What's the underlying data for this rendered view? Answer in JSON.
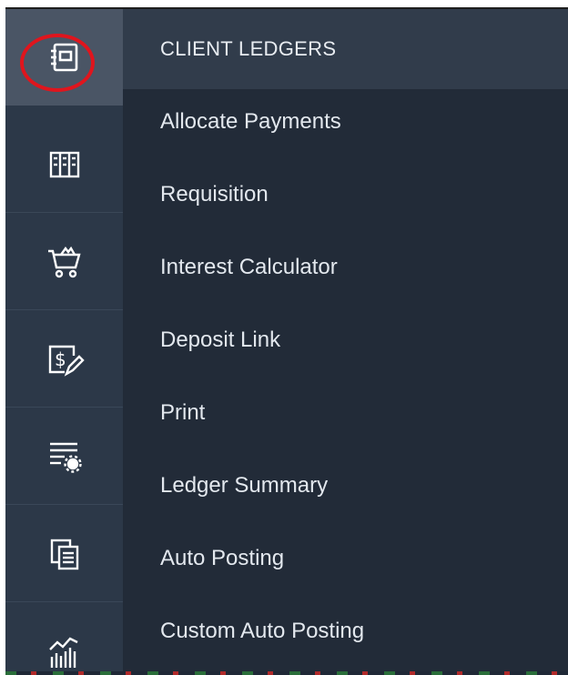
{
  "rail": {
    "items": [
      {
        "icon": "client-ledger-icon",
        "active": true
      },
      {
        "icon": "books-icon"
      },
      {
        "icon": "shopping-cart-icon"
      },
      {
        "icon": "payment-voucher-icon"
      },
      {
        "icon": "list-settings-icon"
      },
      {
        "icon": "documents-icon"
      },
      {
        "icon": "chart-icon"
      }
    ]
  },
  "menu": {
    "header": "CLIENT LEDGERS",
    "items": [
      "Allocate Payments",
      "Requisition",
      "Interest Calculator",
      "Deposit Link",
      "Print",
      "Ledger Summary",
      "Auto Posting",
      "Custom Auto Posting"
    ]
  },
  "colors": {
    "rail_bg": "#2c3848",
    "rail_active_bg": "#4a5565",
    "menu_bg": "#222b38",
    "menu_header_bg": "#313c4b",
    "highlight_ring": "#e0151d"
  }
}
